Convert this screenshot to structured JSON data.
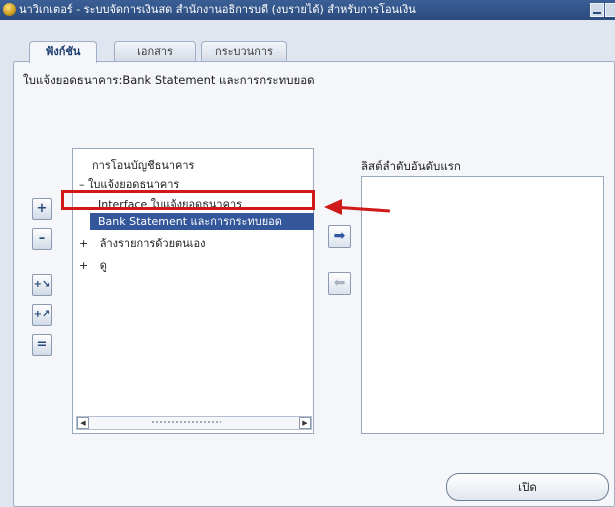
{
  "window": {
    "title": "นาวิเกเตอร์ - ระบบจัดการเงินสด สำนักงานอธิการบดี (งบรายได้) สำหรับการโอนเงิน"
  },
  "tabs": [
    {
      "label": "ฟังก์ชัน",
      "active": true
    },
    {
      "label": "เอกสาร",
      "active": false
    },
    {
      "label": "กระบวนการ",
      "active": false
    }
  ],
  "heading": "ใบแจ้งยอดธนาคาร:Bank Statement และการกระทบยอด",
  "tree": {
    "items": [
      {
        "label": "การโอนบัญชีธนาคาร",
        "prefix": ""
      },
      {
        "label": "ใบแจ้งยอดธนาคาร",
        "prefix": "–"
      },
      {
        "label": "Interface ใบแจ้งยอดธนาคาร",
        "prefix": ""
      },
      {
        "label": "Bank Statement และการกระทบยอด",
        "prefix": "",
        "selected": true
      },
      {
        "label": "ล้างรายการด้วยตนเอง",
        "prefix": "+"
      },
      {
        "label": "ดู",
        "prefix": "+"
      }
    ]
  },
  "side_buttons": [
    "plus",
    "minus",
    "expand-branch",
    "expand-all",
    "collapse-all"
  ],
  "top_list": {
    "label": "ลิสต์ลำดับอันดับแรก",
    "items": []
  },
  "actions": {
    "open_label": "เปิด"
  },
  "annotation_color": "#d01a1a"
}
